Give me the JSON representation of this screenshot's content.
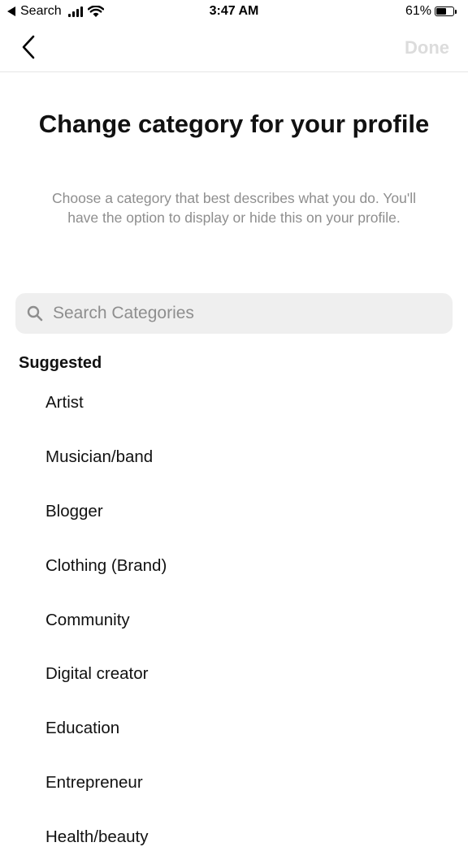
{
  "status_bar": {
    "back_app": "Search",
    "time": "3:47 AM",
    "battery_text": "61%",
    "battery_level": 0.61
  },
  "nav": {
    "back_icon": "chevron-left-icon",
    "done_label": "Done",
    "done_color": "#dcdcdc"
  },
  "header": {
    "title": "Change category for your profile",
    "subtitle": "Choose a category that best describes what you do. You'll have the option to display or hide this on your profile."
  },
  "search": {
    "icon": "search-icon",
    "placeholder": "Search Categories",
    "value": ""
  },
  "suggested": {
    "heading": "Suggested",
    "items": [
      {
        "label": "Artist"
      },
      {
        "label": "Musician/band"
      },
      {
        "label": "Blogger"
      },
      {
        "label": "Clothing (Brand)"
      },
      {
        "label": "Community"
      },
      {
        "label": "Digital creator"
      },
      {
        "label": "Education"
      },
      {
        "label": "Entrepreneur"
      },
      {
        "label": "Health/beauty"
      }
    ]
  }
}
